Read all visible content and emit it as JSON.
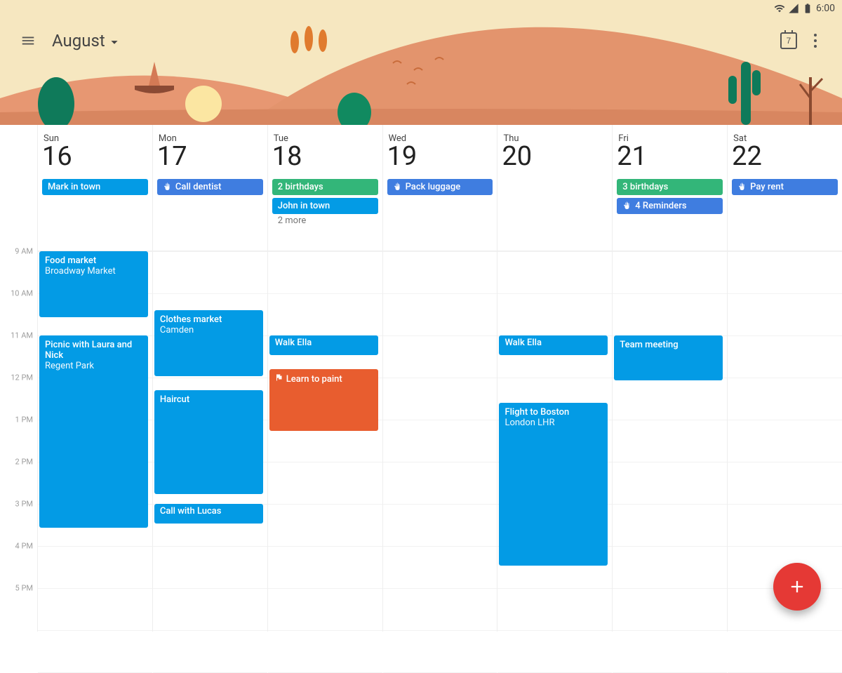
{
  "status": {
    "time": "6:00"
  },
  "toolbar": {
    "month": "August",
    "today_num": "7"
  },
  "colors": {
    "blue": "#039be5",
    "blue2": "#3f7de0",
    "green": "#33b679",
    "orange": "#e85d2f",
    "fab": "#e53935"
  },
  "time_labels": [
    "9 AM",
    "10 AM",
    "11 AM",
    "12 PM",
    "1 PM",
    "2 PM",
    "3 PM",
    "4 PM",
    "5 PM"
  ],
  "hour_height": 60,
  "first_hour": 9,
  "days": [
    {
      "name": "Sun",
      "num": "16",
      "allday": [
        {
          "label": "Mark in town",
          "color": "blue"
        }
      ],
      "events": [
        {
          "title": "Food market",
          "sub": "Broadway Market",
          "start": 9.0,
          "end": 10.6,
          "color": "blue"
        },
        {
          "title": "Picnic with Laura and Nick",
          "sub": "Regent Park",
          "start": 11.0,
          "end": 15.6,
          "color": "blue"
        }
      ]
    },
    {
      "name": "Mon",
      "num": "17",
      "allday": [
        {
          "label": "Call dentist",
          "color": "blue2",
          "icon": "hand"
        }
      ],
      "events": [
        {
          "title": "Clothes market",
          "sub": "Camden",
          "start": 10.4,
          "end": 12.0,
          "color": "blue"
        },
        {
          "title": "Haircut",
          "start": 12.3,
          "end": 14.8,
          "color": "blue"
        },
        {
          "title": "Call with Lucas",
          "start": 15.0,
          "end": 15.5,
          "color": "blue",
          "small": true
        }
      ]
    },
    {
      "name": "Tue",
      "num": "18",
      "allday": [
        {
          "label": "2 birthdays",
          "color": "green"
        },
        {
          "label": "John in town",
          "color": "blue"
        }
      ],
      "more": "2 more",
      "events": [
        {
          "title": "Walk Ella",
          "start": 11.0,
          "end": 11.5,
          "color": "blue",
          "small": true
        },
        {
          "title": "Learn to paint",
          "start": 11.8,
          "end": 13.3,
          "color": "orange",
          "flag": true
        }
      ]
    },
    {
      "name": "Wed",
      "num": "19",
      "allday": [
        {
          "label": "Pack luggage",
          "color": "blue2",
          "icon": "hand"
        }
      ],
      "events": []
    },
    {
      "name": "Thu",
      "num": "20",
      "allday": [],
      "events": [
        {
          "title": "Walk Ella",
          "start": 11.0,
          "end": 11.5,
          "color": "blue",
          "small": true
        },
        {
          "title": "Flight to Boston",
          "sub": "London LHR",
          "start": 12.6,
          "end": 16.5,
          "color": "blue"
        }
      ]
    },
    {
      "name": "Fri",
      "num": "21",
      "allday": [
        {
          "label": "3 birthdays",
          "color": "green"
        },
        {
          "label": "4 Reminders",
          "color": "blue2",
          "icon": "hand"
        }
      ],
      "events": [
        {
          "title": "Team meeting",
          "start": 11.0,
          "end": 12.1,
          "color": "blue"
        }
      ]
    },
    {
      "name": "Sat",
      "num": "22",
      "allday": [
        {
          "label": "Pay rent",
          "color": "blue2",
          "icon": "hand"
        }
      ],
      "events": []
    }
  ]
}
